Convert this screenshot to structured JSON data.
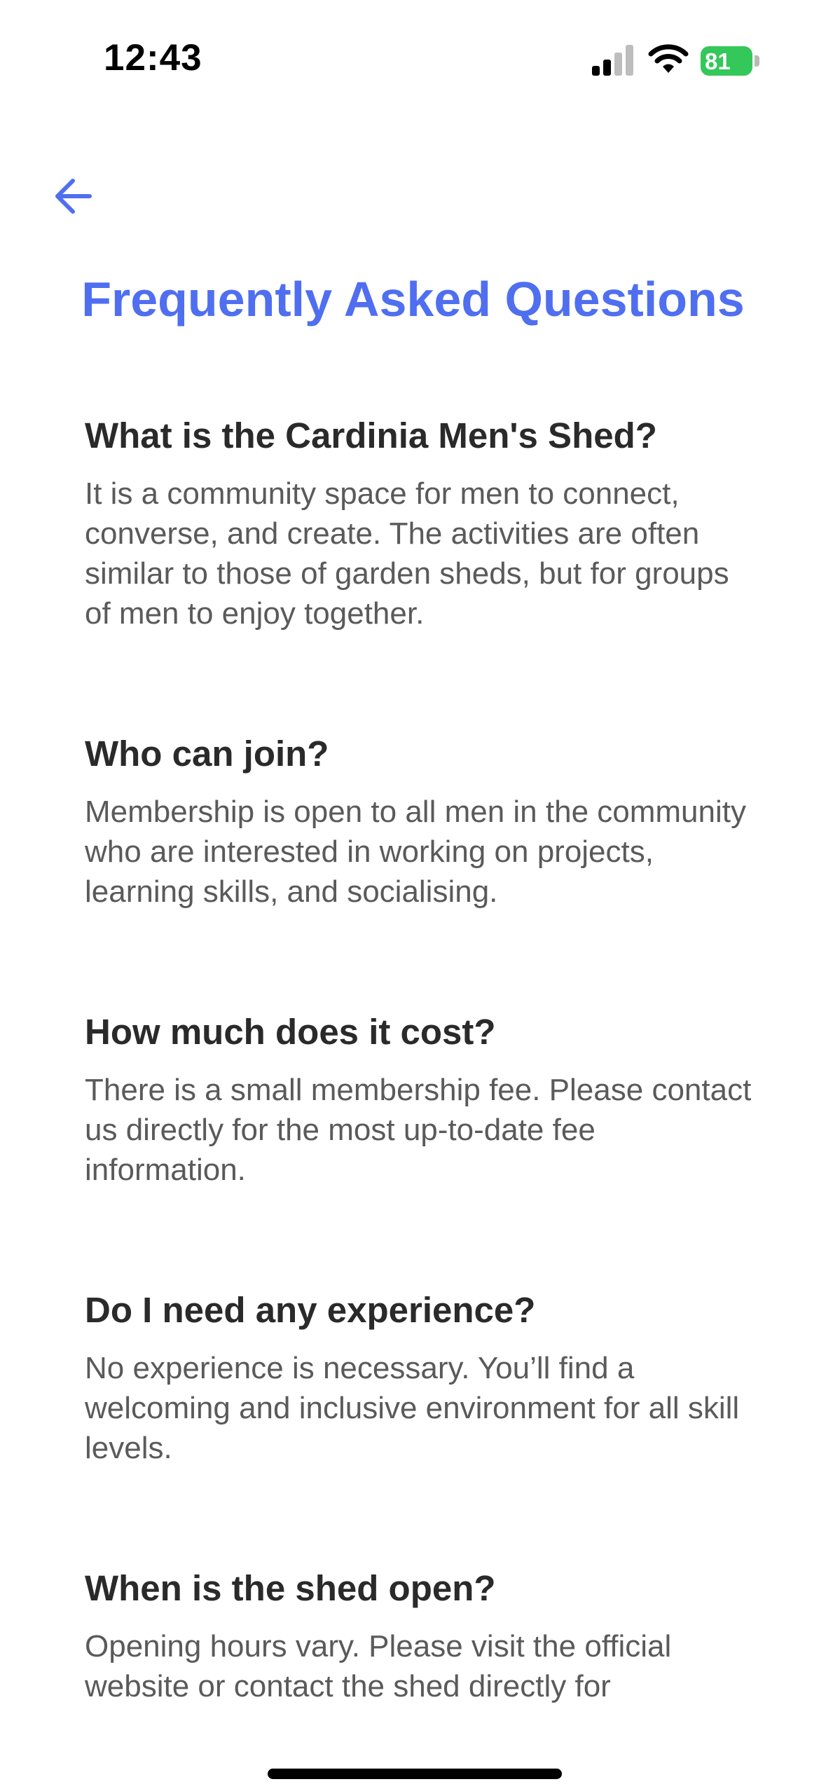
{
  "status_bar": {
    "time": "12:43",
    "battery_level": "81",
    "battery_color": "#34c759",
    "signal_bars_active": 2,
    "signal_bars_total": 4
  },
  "navigation": {
    "back_icon": "arrow-left-icon",
    "accent_color": "#4f6ff0"
  },
  "page": {
    "title": "Frequently Asked Questions"
  },
  "faq": [
    {
      "question": "What is the Cardinia Men's Shed?",
      "answer": "It is a community space for men to connect, converse, and create. The activities are often similar to those of garden sheds, but for groups of men to enjoy together."
    },
    {
      "question": "Who can join?",
      "answer": "Membership is open to all men in the community who are interested in working on projects, learning skills, and socialising."
    },
    {
      "question": "How much does it cost?",
      "answer": "There is a small membership fee. Please contact us directly for the most up-to-date fee information."
    },
    {
      "question": "Do I need any experience?",
      "answer": "No experience is necessary. You’ll find a welcoming and inclusive environment for all skill levels."
    },
    {
      "question": "When is the shed open?",
      "answer": "Opening hours vary. Please visit the official website or contact the shed directly for"
    }
  ]
}
